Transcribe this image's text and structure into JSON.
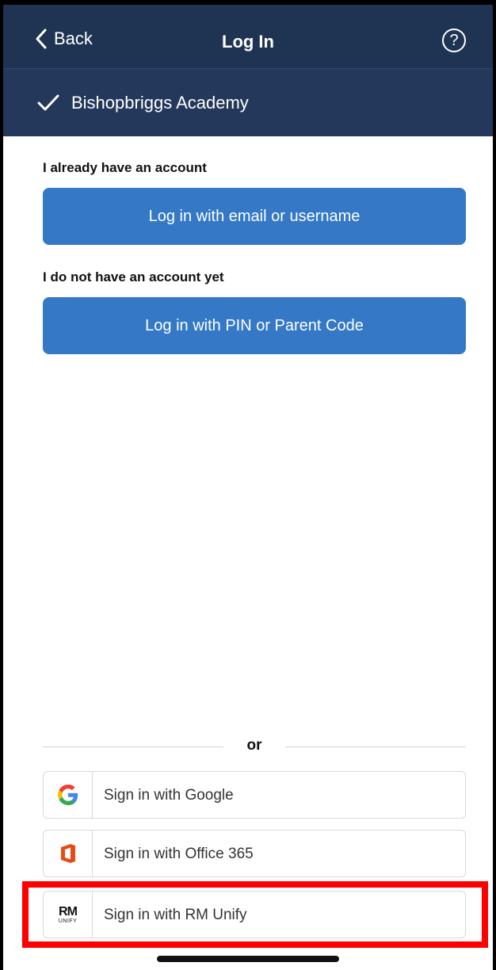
{
  "nav": {
    "back_label": "Back",
    "title": "Log In",
    "help_glyph": "?"
  },
  "school": {
    "name": "Bishopbriggs Academy"
  },
  "account": {
    "existing_label": "I already have an account",
    "email_button": "Log in with email or username",
    "new_label": "I do not have an account yet",
    "pin_button": "Log in with PIN or Parent Code"
  },
  "divider": {
    "text": "or"
  },
  "sso": [
    {
      "label": "Sign in with Google",
      "icon": "google-icon"
    },
    {
      "label": "Sign in with Office 365",
      "icon": "office365-icon"
    },
    {
      "label": "Sign in with RM Unify",
      "icon": "rm-unify-icon",
      "logo_text": "RM",
      "logo_subtext": "UNIFY"
    }
  ],
  "colors": {
    "nav_bg": "#1f3453",
    "school_bar_bg": "#23385a",
    "primary_button": "#3478c6",
    "highlight": "#ff0000"
  }
}
